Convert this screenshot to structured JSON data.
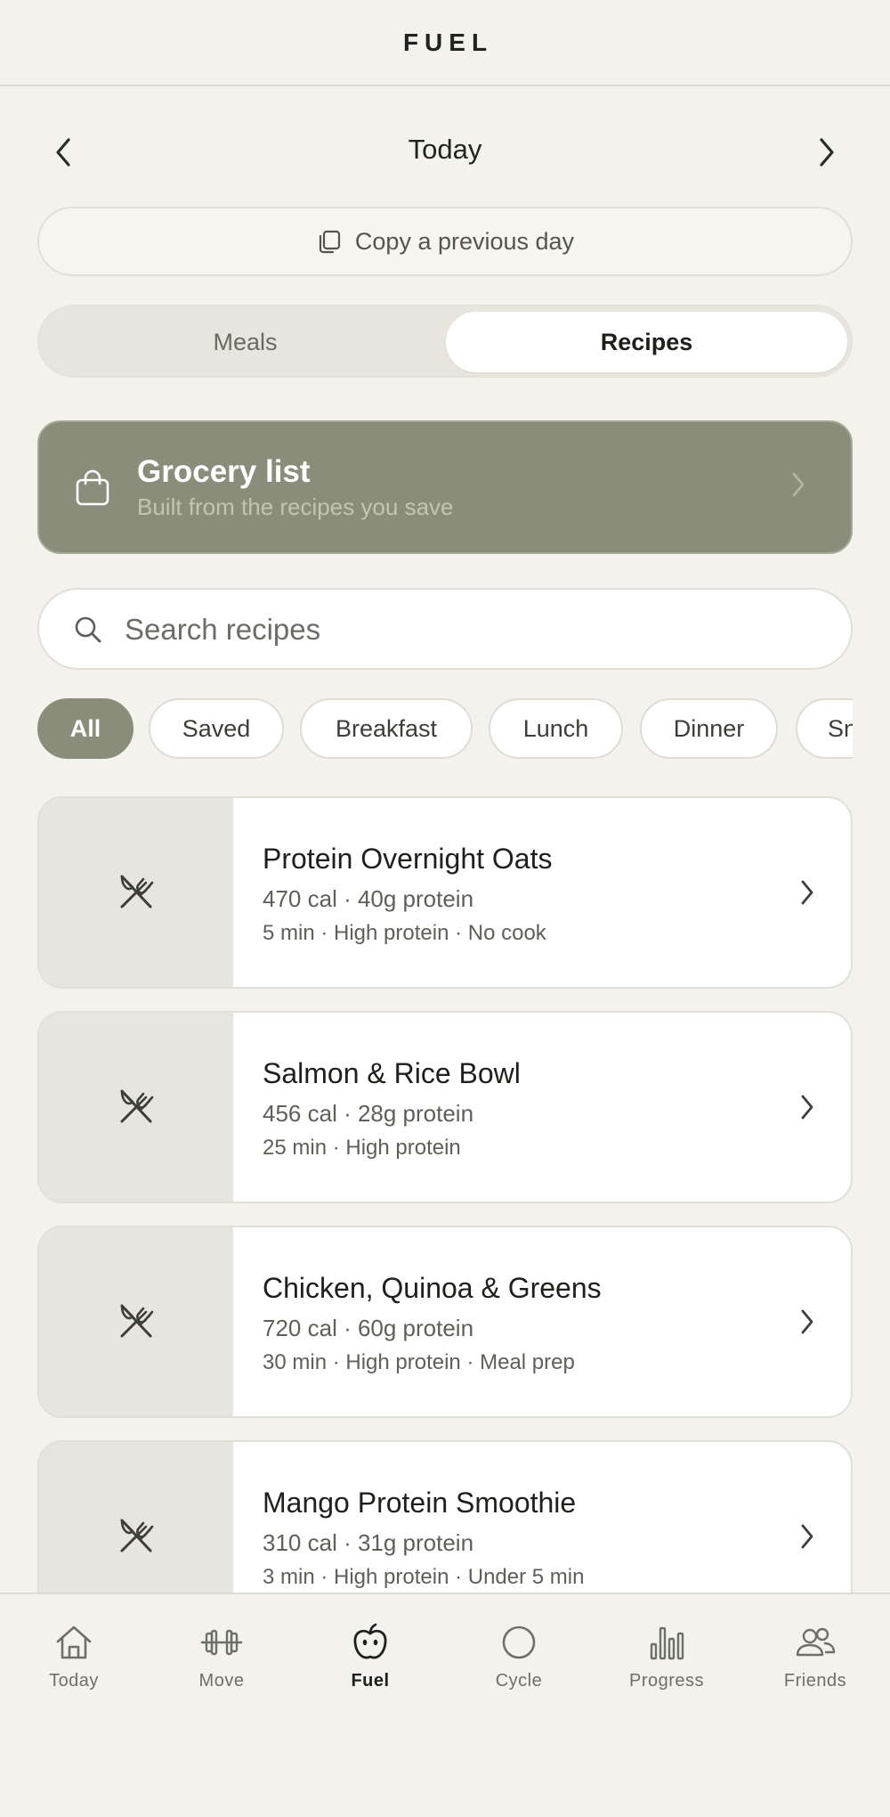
{
  "app": {
    "title": "FUEL"
  },
  "date_nav": {
    "title": "Today",
    "prev_icon": "chevron-left-icon",
    "next_icon": "chevron-right-icon"
  },
  "copy_day": {
    "label": "Copy a previous day",
    "icon": "copy-icon"
  },
  "segment": {
    "meals": "Meals",
    "recipes": "Recipes",
    "selected": "Recipes"
  },
  "grocery": {
    "title": "Grocery list",
    "subtitle": "Built from the recipes you save",
    "icon": "shopping-bag-icon"
  },
  "search": {
    "placeholder": "Search recipes",
    "value": ""
  },
  "filters": {
    "selected": "All",
    "items": [
      "All",
      "Saved",
      "Breakfast",
      "Lunch",
      "Dinner",
      "Sn"
    ]
  },
  "recipes": [
    {
      "name": "Protein Overnight Oats",
      "nutrition": "470 cal · 40g protein",
      "tags": "5 min · High protein · No cook"
    },
    {
      "name": "Salmon & Rice Bowl",
      "nutrition": "456 cal · 28g protein",
      "tags": "25 min · High protein"
    },
    {
      "name": "Chicken, Quinoa & Greens",
      "nutrition": "720 cal · 60g protein",
      "tags": "30 min · High protein · Meal prep"
    },
    {
      "name": "Mango Protein Smoothie",
      "nutrition": "310 cal · 31g protein",
      "tags": "3 min · High protein · Under 5 min"
    }
  ],
  "tabbar": {
    "active": "Fuel",
    "items": [
      {
        "label": "Today",
        "icon": "home-icon"
      },
      {
        "label": "Move",
        "icon": "dumbbell-icon"
      },
      {
        "label": "Fuel",
        "icon": "apple-icon"
      },
      {
        "label": "Cycle",
        "icon": "circle-icon"
      },
      {
        "label": "Progress",
        "icon": "bar-chart-icon"
      },
      {
        "label": "Friends",
        "icon": "people-icon"
      }
    ]
  },
  "colors": {
    "background": "#f3f2ed",
    "accent": "#8b8d7b",
    "card": "#ffffff",
    "thumb": "#e7e5dd"
  }
}
